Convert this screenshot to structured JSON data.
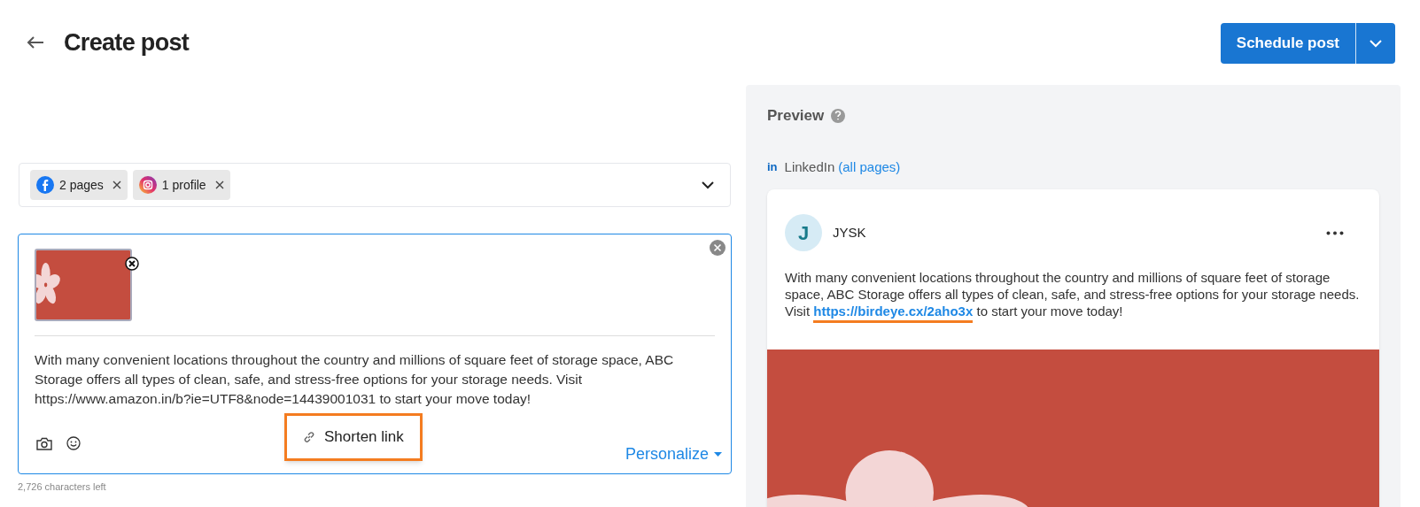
{
  "header": {
    "title": "Create post",
    "primary_button": "Schedule post"
  },
  "channels": [
    {
      "kind": "facebook",
      "label": "2 pages"
    },
    {
      "kind": "instagram",
      "label": "1 profile"
    }
  ],
  "editor": {
    "text": "With many convenient locations throughout the country and millions of square feet of storage space, ABC Storage offers all types of clean, safe, and stress-free options for your storage needs. Visit https://www.amazon.in/b?ie=UTF8&node=14439001031 to start your move today!",
    "popup": {
      "label": "Shorten link",
      "highlighted": true
    },
    "personalize": "Personalize",
    "counter": "2,726 characters left"
  },
  "preview": {
    "title": "Preview",
    "network_logo": "in",
    "network": "LinkedIn",
    "network_scope": "(all pages)",
    "post": {
      "avatar": "J",
      "author": "JYSK",
      "text_before": "With many convenient locations throughout the country and millions of square feet of storage space, ABC Storage offers all types of clean, safe, and stress-free options for your storage needs. Visit",
      "link": "https://birdeye.cx/2aho3x",
      "link_highlighted": true,
      "text_after": "to start your move today!"
    }
  }
}
